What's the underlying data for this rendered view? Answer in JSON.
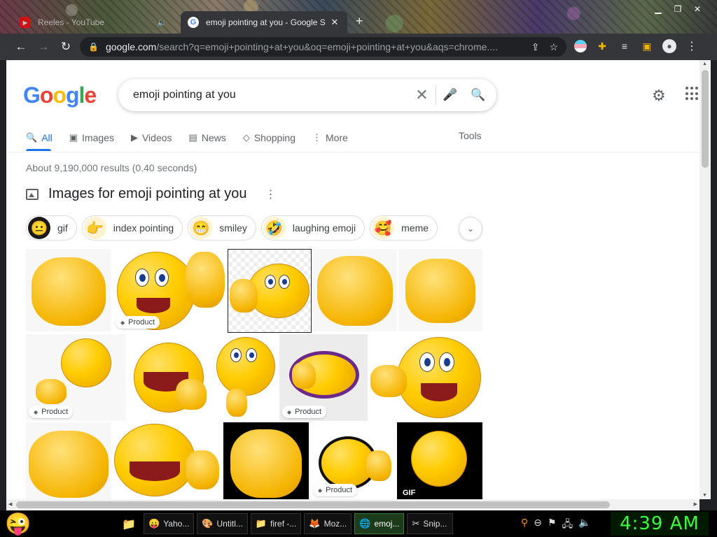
{
  "browser": {
    "tabs": [
      {
        "title": "Reeles - YouTube",
        "favicon": "youtube-icon",
        "active": false
      },
      {
        "title": "emoji pointing at you - Google S",
        "favicon": "google-g-icon",
        "active": true
      }
    ],
    "new_tab_label": "+",
    "url_host": "google.com",
    "url_path": "/search?q=emoji+pointing+at+you&oq=emoji+pointing+at+you&aqs=chrome...."
  },
  "google": {
    "logo_letters": [
      "G",
      "o",
      "o",
      "g",
      "l",
      "e"
    ],
    "query": "emoji pointing at you",
    "tabs": [
      {
        "label": "All",
        "icon": "search-icon",
        "active": true
      },
      {
        "label": "Images",
        "icon": "image-icon"
      },
      {
        "label": "Videos",
        "icon": "play-icon"
      },
      {
        "label": "News",
        "icon": "news-icon"
      },
      {
        "label": "Shopping",
        "icon": "tag-icon"
      },
      {
        "label": "More",
        "icon": "more-vert-icon"
      }
    ],
    "tools_label": "Tools",
    "stats": "About 9,190,000 results (0.40 seconds)",
    "images_header": "Images for emoji pointing at you",
    "chips": [
      {
        "label": "gif",
        "thumb": "😐"
      },
      {
        "label": "index pointing",
        "thumb": "👉"
      },
      {
        "label": "smiley",
        "thumb": "😁"
      },
      {
        "label": "laughing emoji",
        "thumb": "🤣"
      },
      {
        "label": "meme",
        "thumb": "🥰"
      }
    ],
    "tags": {
      "product": "Product",
      "gif": "GIF"
    }
  },
  "taskbar": {
    "items": [
      {
        "label": "Yaho...",
        "icon": "😛"
      },
      {
        "label": "Untitl...",
        "icon": "🎨"
      },
      {
        "label": "firef -...",
        "icon": "📁"
      },
      {
        "label": "Moz...",
        "icon": "🦊"
      },
      {
        "label": "emoj...",
        "icon": "🌐",
        "active": true
      },
      {
        "label": "Snip...",
        "icon": "✂"
      }
    ],
    "clock": "4:39 AM"
  }
}
